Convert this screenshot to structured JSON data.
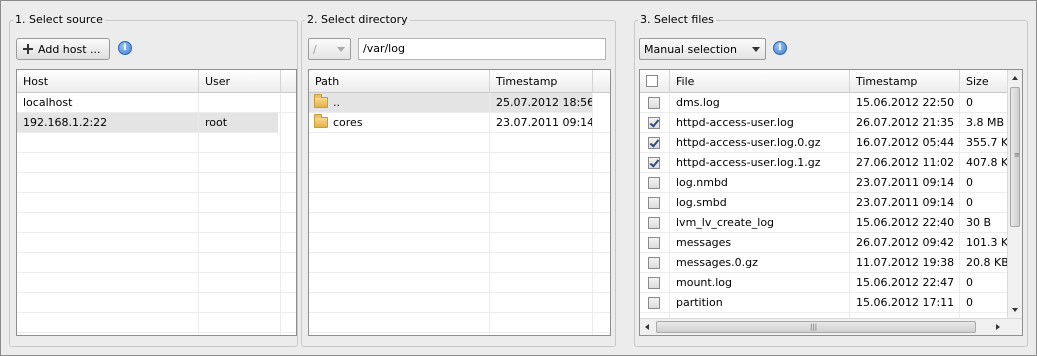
{
  "source": {
    "title": "1. Select source",
    "add_host_label": "Add host ...",
    "columns": [
      "Host",
      "User"
    ],
    "rows": [
      {
        "host": "localhost",
        "user": ""
      },
      {
        "host": "192.168.1.2:22",
        "user": "root"
      }
    ]
  },
  "directory": {
    "title": "2. Select directory",
    "root_option": "/",
    "path_value": "/var/log",
    "columns": [
      "Path",
      "Timestamp"
    ],
    "rows": [
      {
        "path": "..",
        "timestamp": "25.07.2012 18:56"
      },
      {
        "path": "cores",
        "timestamp": "23.07.2011 09:14"
      }
    ]
  },
  "files": {
    "title": "3. Select files",
    "mode_option": "Manual selection",
    "columns": [
      "File",
      "Timestamp",
      "Size"
    ],
    "rows": [
      {
        "checked": false,
        "file": "dms.log",
        "timestamp": "15.06.2012 22:50",
        "size": "0"
      },
      {
        "checked": true,
        "file": "httpd-access-user.log",
        "timestamp": "26.07.2012 21:35",
        "size": "3.8 MB"
      },
      {
        "checked": true,
        "file": "httpd-access-user.log.0.gz",
        "timestamp": "16.07.2012 05:44",
        "size": "355.7 K"
      },
      {
        "checked": true,
        "file": "httpd-access-user.log.1.gz",
        "timestamp": "27.06.2012 11:02",
        "size": "407.8 K"
      },
      {
        "checked": false,
        "file": "log.nmbd",
        "timestamp": "23.07.2011 09:14",
        "size": "0"
      },
      {
        "checked": false,
        "file": "log.smbd",
        "timestamp": "23.07.2011 09:14",
        "size": "0"
      },
      {
        "checked": false,
        "file": "lvm_lv_create_log",
        "timestamp": "15.06.2012 22:40",
        "size": "30 B"
      },
      {
        "checked": false,
        "file": "messages",
        "timestamp": "26.07.2012 09:42",
        "size": "101.3 K"
      },
      {
        "checked": false,
        "file": "messages.0.gz",
        "timestamp": "11.07.2012 19:38",
        "size": "20.8 KB"
      },
      {
        "checked": false,
        "file": "mount.log",
        "timestamp": "15.06.2012 22:47",
        "size": "0"
      },
      {
        "checked": false,
        "file": "partition",
        "timestamp": "15.06.2012 17:11",
        "size": "0"
      }
    ]
  },
  "icons": {
    "add": "plus-icon",
    "info": "info-icon",
    "folder": "folder-icon",
    "info_letter": "i"
  },
  "colors": {
    "selected_row": "#e4e4e4",
    "info_blue": "#3f7fd0",
    "folder_yellow": "#e3b24c"
  }
}
